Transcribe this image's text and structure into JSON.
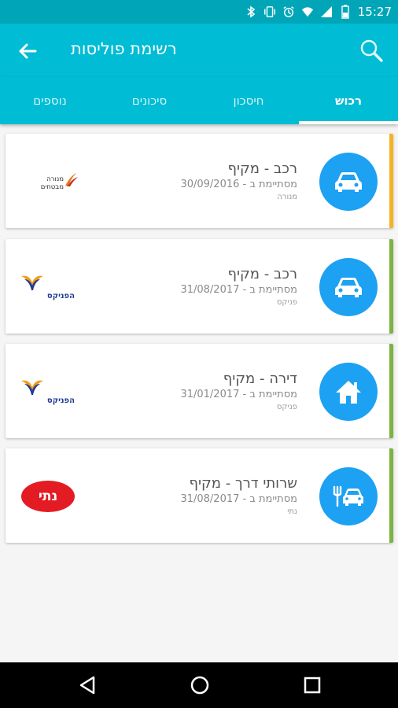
{
  "status": {
    "time": "15:27",
    "icons": [
      "bluetooth-icon",
      "vibrate-icon",
      "alarm-icon",
      "wifi-icon",
      "signal-icon",
      "battery-icon"
    ]
  },
  "header": {
    "title": "רשימת פוליסות",
    "back_icon": "arrow-back-icon",
    "search_icon": "search-icon"
  },
  "tabs": [
    {
      "label": "רכוש",
      "active": true
    },
    {
      "label": "חיסכון",
      "active": false
    },
    {
      "label": "סיכונים",
      "active": false
    },
    {
      "label": "נוספים",
      "active": false
    }
  ],
  "policies": [
    {
      "title": "רכב - מקיף",
      "date": "מסתיימת ב - 30/09/2016",
      "company": "מנורה",
      "icon": "car-icon",
      "stripe_color": "#f5b324",
      "logo": "menora-logo",
      "logo_text": "מנורה מבטחים"
    },
    {
      "title": "רכב - מקיף",
      "date": "מסתיימת ב - 31/08/2017",
      "company": "פניקס",
      "icon": "car-icon",
      "stripe_color": "#7cb342",
      "logo": "phoenix-logo",
      "logo_text": "הפניקס"
    },
    {
      "title": "דירה - מקיף",
      "date": "מסתיימת ב - 31/01/2017",
      "company": "פניקס",
      "icon": "home-icon",
      "stripe_color": "#7cb342",
      "logo": "phoenix-logo",
      "logo_text": "הפניקס"
    },
    {
      "title": "שרותי דרך - מקיף",
      "date": "מסתיימת ב - 31/08/2017",
      "company": "נתי",
      "icon": "road-service-icon",
      "stripe_color": "#7cb342",
      "logo": "nati-logo",
      "logo_text": "נתי"
    }
  ],
  "colors": {
    "primary": "#00bcd4",
    "status": "#00a6b8",
    "icon_circle": "#1da1f2",
    "warning": "#f5b324",
    "ok": "#7cb342"
  },
  "navbar": {
    "icons": [
      "nav-back-icon",
      "nav-home-icon",
      "nav-recents-icon"
    ]
  }
}
